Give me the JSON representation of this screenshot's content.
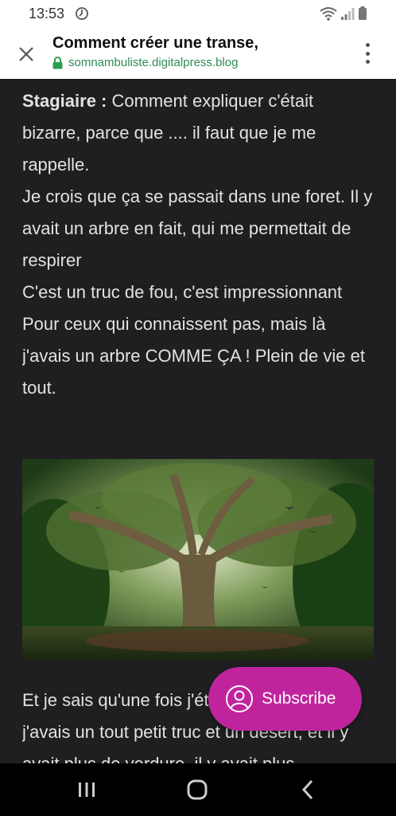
{
  "status": {
    "time": "13:53"
  },
  "toolbar": {
    "title": "Comment créer une transe,",
    "url": "somnambuliste.digitalpress.blog"
  },
  "article": {
    "speaker": "Stagiaire :",
    "lines": [
      " Comment expliquer c'était bizarre, parce que .... il faut que je me rappelle.",
      "Je crois que ça se passait dans une foret. Il y avait un arbre en fait, qui me permettait de respirer",
      "C'est un truc de fou, c'est impressionnant",
      "Pour ceux qui connaissent pas, mais là j'avais un arbre COMME ÇA ! Plein de vie et tout."
    ],
    "after_image_text": "Et je sais qu'une fois j'étais dans un arbre, j'avais un tout petit truc et un désert, et il y avait plus de verdure, il y avait plus"
  },
  "subscribe": {
    "label": "Subscribe"
  },
  "colors": {
    "page_bg": "#1f1f21",
    "text": "#e2e2e2",
    "accent": "#c0249d",
    "url_green": "#2e8b57"
  },
  "icons": [
    "close-icon",
    "lock-icon",
    "more-vert-icon",
    "wifi-icon",
    "signal-icon",
    "battery-icon",
    "user-icon",
    "recent-apps-icon",
    "home-icon",
    "back-icon"
  ]
}
